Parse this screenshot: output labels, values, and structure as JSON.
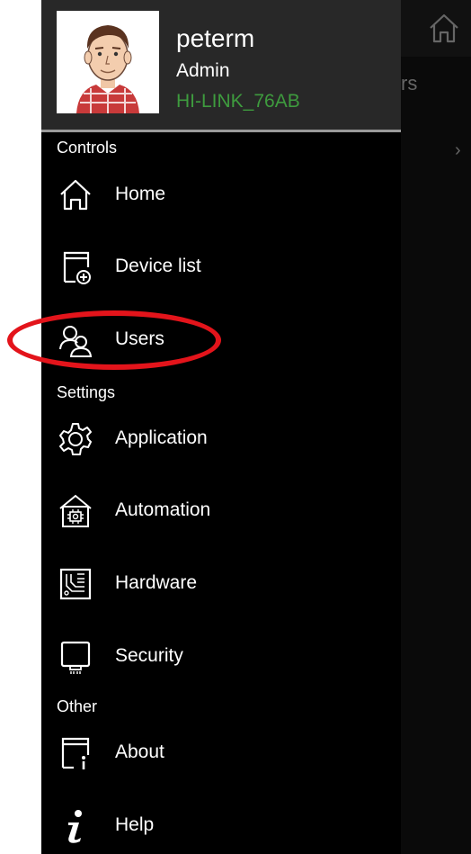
{
  "background": {
    "partial_title": "rs",
    "home_icon": "home-icon",
    "chevron": "›"
  },
  "drawer": {
    "user": {
      "name": "peterm",
      "role": "Admin",
      "network": "HI-LINK_76AB",
      "network_color": "#3e9b3e"
    },
    "sections": [
      {
        "title": "Controls",
        "items": [
          {
            "label": "Home",
            "icon": "home-icon"
          },
          {
            "label": "Device list",
            "icon": "device-add-icon"
          },
          {
            "label": "Users",
            "icon": "users-icon",
            "highlighted": true
          }
        ]
      },
      {
        "title": "Settings",
        "items": [
          {
            "label": "Application",
            "icon": "gear-icon"
          },
          {
            "label": "Automation",
            "icon": "automation-house-icon"
          },
          {
            "label": "Hardware",
            "icon": "circuit-board-icon"
          },
          {
            "label": "Security",
            "icon": "security-device-icon"
          }
        ]
      },
      {
        "title": "Other",
        "items": [
          {
            "label": "About",
            "icon": "about-icon"
          },
          {
            "label": "Help",
            "icon": "info-icon"
          }
        ]
      }
    ]
  },
  "colors": {
    "drawer_bg": "#000000",
    "header_bg": "#282828",
    "highlight_ring": "#e3141b"
  }
}
